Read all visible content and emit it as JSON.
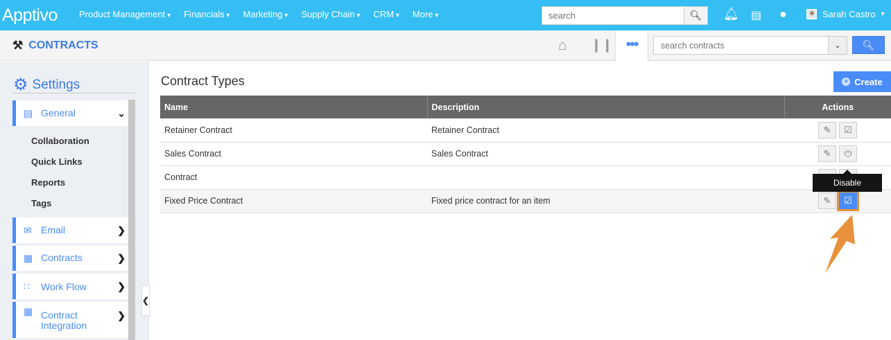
{
  "topbar": {
    "logo": "Apptivo",
    "nav": [
      "Product Management",
      "Financials",
      "Marketing",
      "Supply Chain",
      "CRM",
      "More"
    ],
    "search_placeholder": "search",
    "user_name": "Sarah Castro"
  },
  "subbar": {
    "app_title": "CONTRACTS",
    "search_placeholder": "search contracts"
  },
  "sidebar": {
    "title": "Settings",
    "general": "General",
    "sub_items": [
      "Collaboration",
      "Quick Links",
      "Reports",
      "Tags"
    ],
    "modules": [
      "Email",
      "Contracts",
      "Work Flow",
      "Contract Integration"
    ]
  },
  "main": {
    "title": "Contract Types",
    "create_label": "Create",
    "columns": [
      "Name",
      "Description",
      "Actions"
    ],
    "rows": [
      {
        "name": "Retainer Contract",
        "description": "Retainer Contract"
      },
      {
        "name": "Sales Contract",
        "description": "Sales Contract"
      },
      {
        "name": "Contract",
        "description": ""
      },
      {
        "name": "Fixed Price Contract",
        "description": "Fixed price contract for an item"
      }
    ],
    "tooltip": "Disable"
  },
  "colors": {
    "topbar": "#35bef3",
    "accent": "#4a8cf7",
    "highlight": "#e8913a",
    "header": "#666666"
  }
}
